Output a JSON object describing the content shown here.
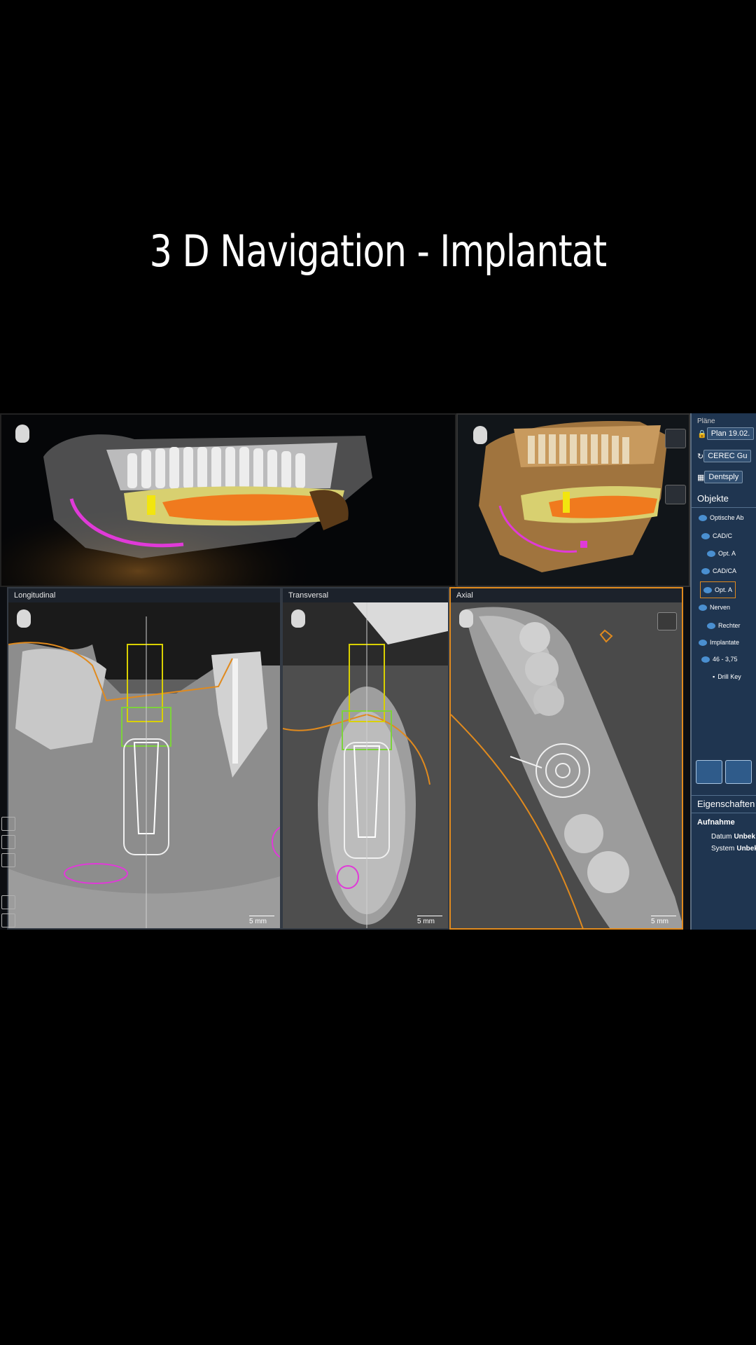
{
  "title": "3 D Navigation - Implantat",
  "views": {
    "longitudinal": {
      "label": "Longitudinal",
      "scale": "5 mm"
    },
    "transversal": {
      "label": "Transversal",
      "scale": "5 mm"
    },
    "axial": {
      "label": "Axial",
      "scale": "5 mm"
    }
  },
  "sidebar": {
    "header": "Pläne",
    "plan_label": "Plan 19.02.",
    "cerec_label": "CEREC Gu",
    "dentsply_label": "Dentsply",
    "objects_title": "Objekte",
    "tree": [
      {
        "label": "Optische Ab"
      },
      {
        "label": "CAD/C"
      },
      {
        "label": "Opt. A"
      },
      {
        "label": "CAD/CA"
      },
      {
        "label": "Opt. A"
      },
      {
        "label": "Nerven"
      },
      {
        "label": "Rechter"
      },
      {
        "label": "Implantate"
      },
      {
        "label": "46 - 3,75"
      },
      {
        "label": "Drill Key"
      }
    ],
    "properties_title": "Eigenschaften",
    "recording_label": "Aufnahme",
    "date_key": "Datum",
    "date_value": "Unbek",
    "system_key": "System",
    "system_value": "Unbek"
  },
  "colors": {
    "nerve": "#e03ad8",
    "implant_marker": "#f2e50f",
    "crown_overlay": "#f07a1e",
    "active_border": "#e08a1e",
    "sidebar_bg": "#1f3550"
  }
}
